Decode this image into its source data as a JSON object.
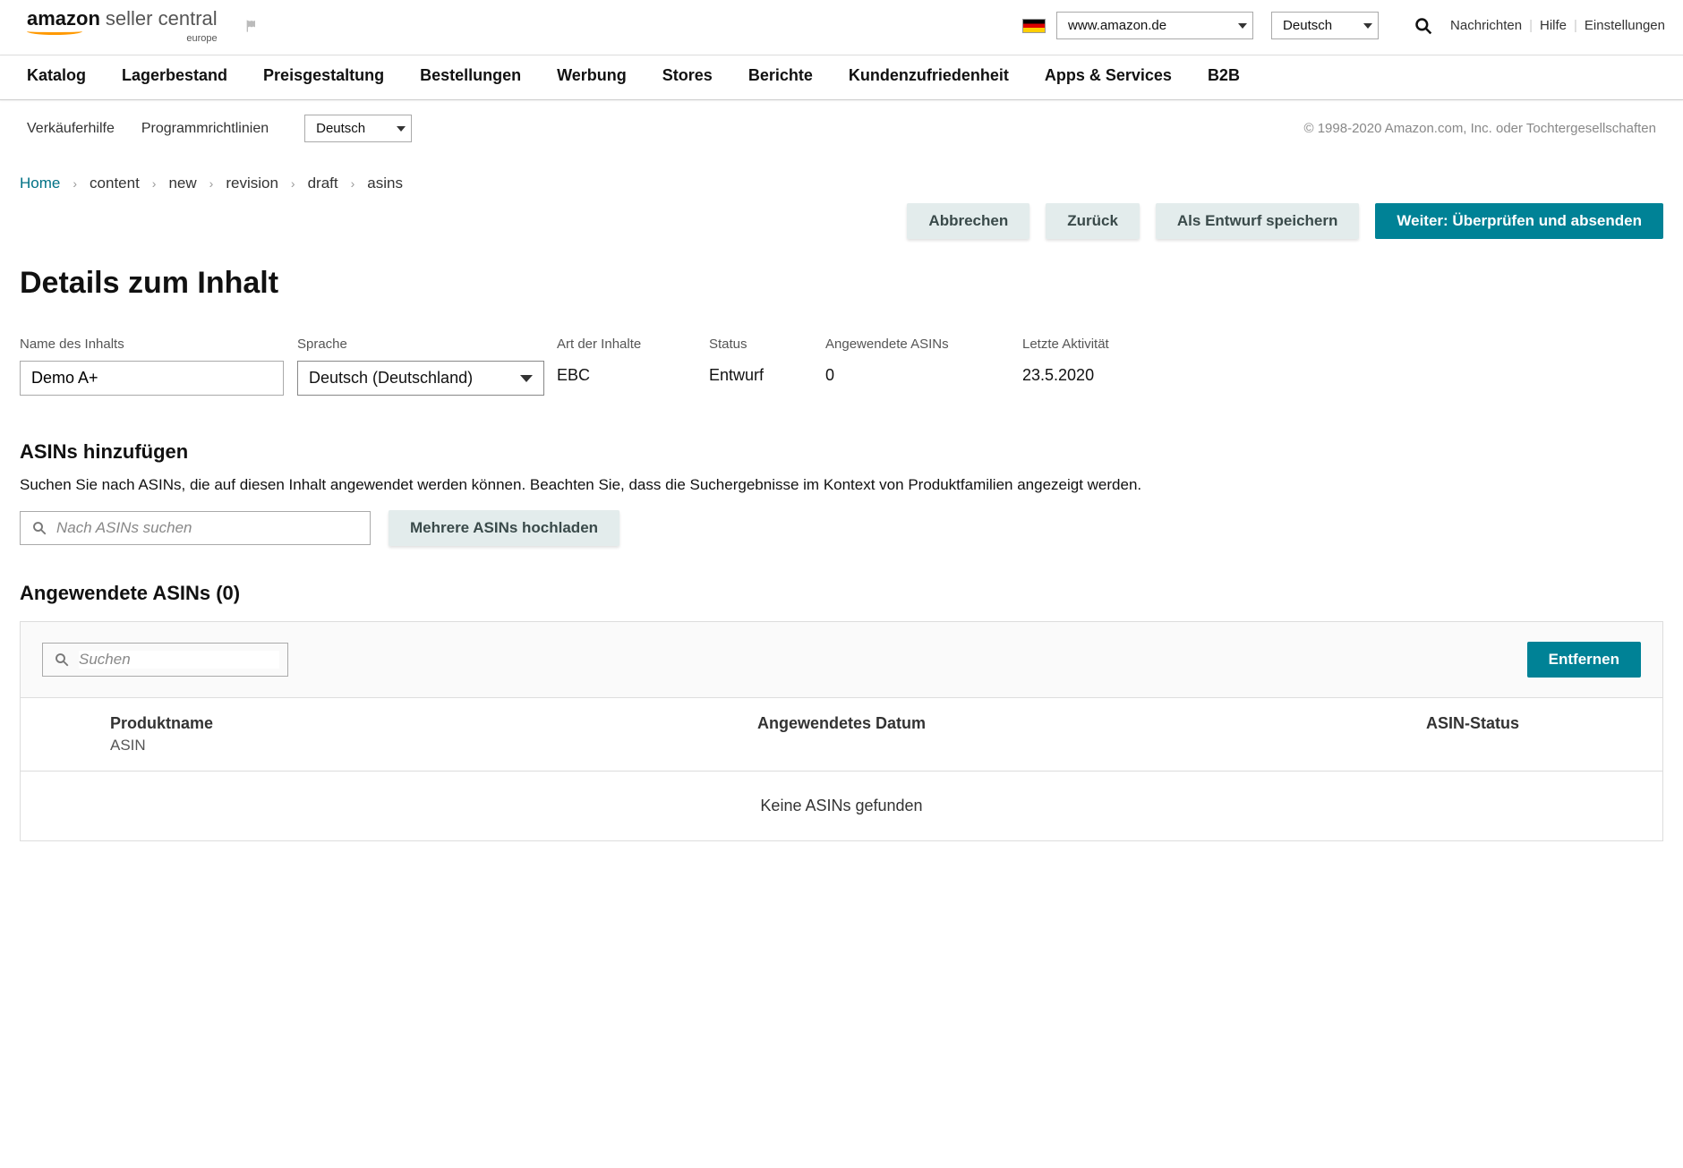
{
  "header": {
    "logo_amazon": "amazon",
    "logo_seller": "seller central",
    "logo_region": "europe",
    "marketplace": "www.amazon.de",
    "language": "Deutsch",
    "links": {
      "messages": "Nachrichten",
      "help": "Hilfe",
      "settings": "Einstellungen"
    }
  },
  "nav": {
    "items": [
      "Katalog",
      "Lagerbestand",
      "Preisgestaltung",
      "Bestellungen",
      "Werbung",
      "Stores",
      "Berichte",
      "Kundenzufriedenheit",
      "Apps & Services",
      "B2B"
    ]
  },
  "subbar": {
    "seller_help": "Verkäuferhilfe",
    "policies": "Programmrichtlinien",
    "language": "Deutsch",
    "copyright": "© 1998-2020 Amazon.com, Inc. oder Tochtergesellschaften"
  },
  "breadcrumb": {
    "home": "Home",
    "items": [
      "content",
      "new",
      "revision",
      "draft",
      "asins"
    ]
  },
  "actions": {
    "cancel": "Abbrechen",
    "back": "Zurück",
    "save_draft": "Als Entwurf speichern",
    "next": "Weiter: Überprüfen und absenden"
  },
  "page_title": "Details zum Inhalt",
  "details": {
    "name_label": "Name des Inhalts",
    "name_value": "Demo A+",
    "language_label": "Sprache",
    "language_value": "Deutsch (Deutschland)",
    "type_label": "Art der Inhalte",
    "type_value": "EBC",
    "status_label": "Status",
    "status_value": "Entwurf",
    "applied_label": "Angewendete ASINs",
    "applied_value": "0",
    "activity_label": "Letzte Aktivität",
    "activity_value": "23.5.2020"
  },
  "add_asins": {
    "heading": "ASINs hinzufügen",
    "help": "Suchen Sie nach ASINs, die auf diesen Inhalt angewendet werden können. Beachten Sie, dass die Suchergebnisse im Kontext von Produktfamilien angezeigt werden.",
    "search_placeholder": "Nach ASINs suchen",
    "upload_btn": "Mehrere ASINs hochladen"
  },
  "applied": {
    "heading": "Angewendete ASINs (0)",
    "filter_placeholder": "Suchen",
    "remove_btn": "Entfernen",
    "col_product": "Produktname",
    "col_product_sub": "ASIN",
    "col_date": "Angewendetes Datum",
    "col_status": "ASIN-Status",
    "empty": "Keine ASINs gefunden"
  }
}
